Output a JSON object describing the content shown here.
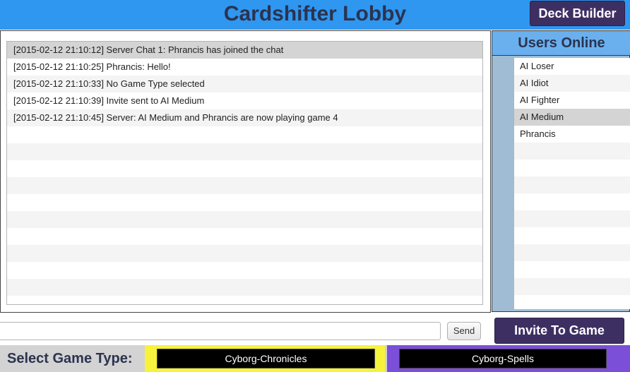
{
  "header": {
    "title": "Cardshifter Lobby",
    "deck_builder_label": "Deck Builder"
  },
  "chat": {
    "messages": [
      "[2015-02-12 21:10:12] Server Chat 1: Phrancis has joined the chat",
      "[2015-02-12 21:10:25] Phrancis: Hello!",
      "[2015-02-12 21:10:33] No Game Type selected",
      "[2015-02-12 21:10:39] Invite sent to AI Medium",
      "[2015-02-12 21:10:45] Server: AI Medium and Phrancis are now playing game 4"
    ],
    "selected_index": 0,
    "input_value": "",
    "send_label": "Send"
  },
  "users": {
    "title": "Users Online",
    "list": [
      "AI Loser",
      "AI Idiot",
      "AI Fighter",
      "AI Medium",
      "Phrancis"
    ],
    "selected_index": 3
  },
  "actions": {
    "invite_label": "Invite To Game"
  },
  "game_type": {
    "label": "Select Game Type:",
    "options": [
      "Cyborg-Chronicles",
      "Cyborg-Spells"
    ]
  },
  "colors": {
    "header_bg": "#2f97f0",
    "dark_button": "#3e2f63",
    "users_header_bg": "#6ab0ee",
    "game_type_yellow": "#f7f23c",
    "game_type_purple": "#7b4fd8"
  }
}
